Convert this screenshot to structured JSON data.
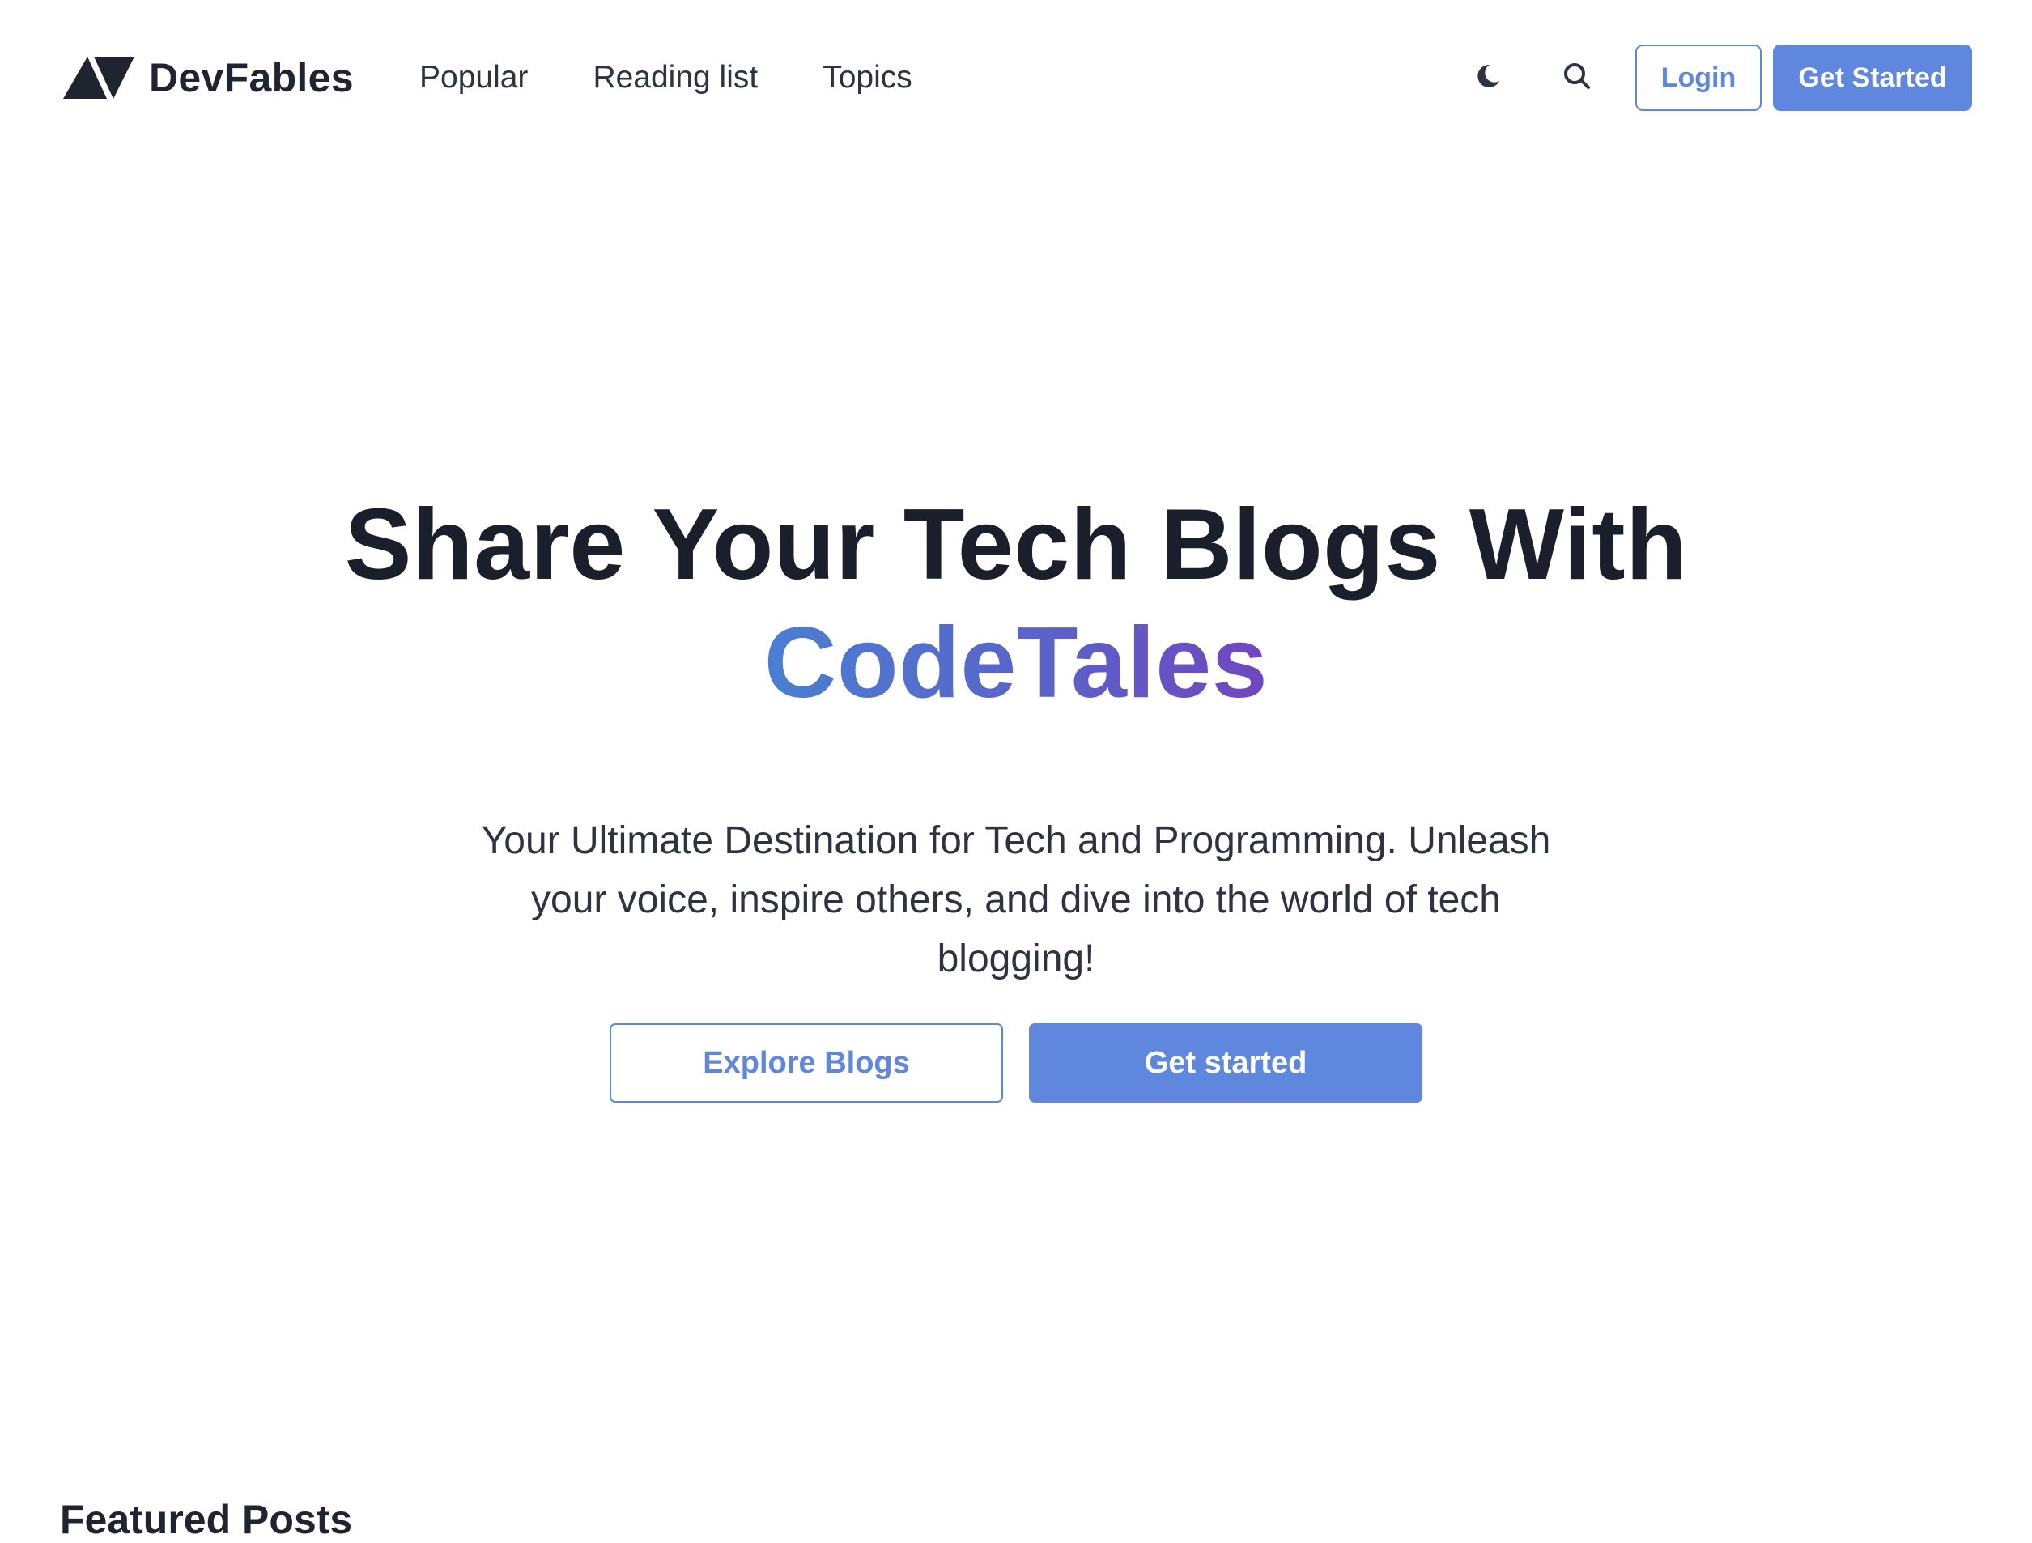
{
  "brand": {
    "name": "DevFables",
    "logo_icon": "devfables-logo-icon"
  },
  "nav": {
    "links": [
      {
        "label": "Popular"
      },
      {
        "label": "Reading list"
      },
      {
        "label": "Topics"
      }
    ],
    "theme_toggle_icon": "moon-icon",
    "search_icon": "search-icon",
    "login_label": "Login",
    "get_started_label": "Get Started"
  },
  "hero": {
    "title_line1": "Share Your Tech Blogs With",
    "title_highlight": "CodeTales",
    "subtitle": "Your Ultimate Destination for Tech and Programming. Unleash your voice, inspire others, and dive into the world of tech blogging!",
    "explore_label": "Explore Blogs",
    "get_started_label": "Get started"
  },
  "featured": {
    "title": "Featured Posts"
  },
  "colors": {
    "accent": "#5f87dd",
    "text_dark": "#1a1f2b",
    "gradient_start": "#4a7fd2",
    "gradient_end": "#7046be"
  }
}
